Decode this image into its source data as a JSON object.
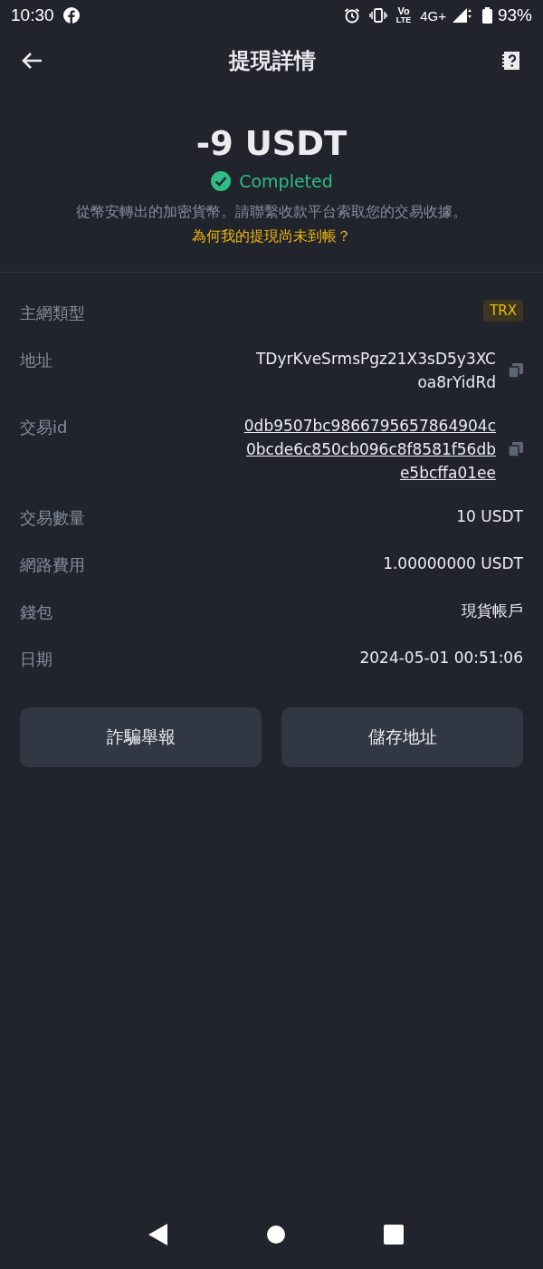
{
  "status_bar": {
    "time": "10:30",
    "volte_top": "Vo",
    "volte_bottom": "LTE",
    "network": "4G+",
    "battery": "93%"
  },
  "header": {
    "title": "提現詳情"
  },
  "summary": {
    "amount": "-9 USDT",
    "status": "Completed",
    "description": "從幣安轉出的加密貨幣。請聯繫收款平台索取您的交易收據。",
    "help_link": "為何我的提現尚未到帳？"
  },
  "details": [
    {
      "label": "主網類型",
      "kind": "badge",
      "lines": [
        "TRX"
      ]
    },
    {
      "label": "地址",
      "kind": "copy",
      "lines": [
        "TDyrKveSrmsPgz21X3sD5y3XC",
        "oa8rYidRd"
      ]
    },
    {
      "label": "交易id",
      "kind": "link_copy",
      "lines": [
        "0db9507bc9866795657864904c",
        "0bcde6c850cb096c8f8581f56db",
        "e5bcffa01ee"
      ]
    },
    {
      "label": "交易數量",
      "kind": "text",
      "lines": [
        "10 USDT"
      ]
    },
    {
      "label": "網路費用",
      "kind": "text",
      "lines": [
        "1.00000000 USDT"
      ]
    },
    {
      "label": "錢包",
      "kind": "text",
      "lines": [
        "現貨帳戶"
      ]
    },
    {
      "label": "日期",
      "kind": "text",
      "lines": [
        "2024-05-01 00:51:06"
      ]
    }
  ],
  "buttons": [
    "詐騙舉報",
    "儲存地址"
  ]
}
